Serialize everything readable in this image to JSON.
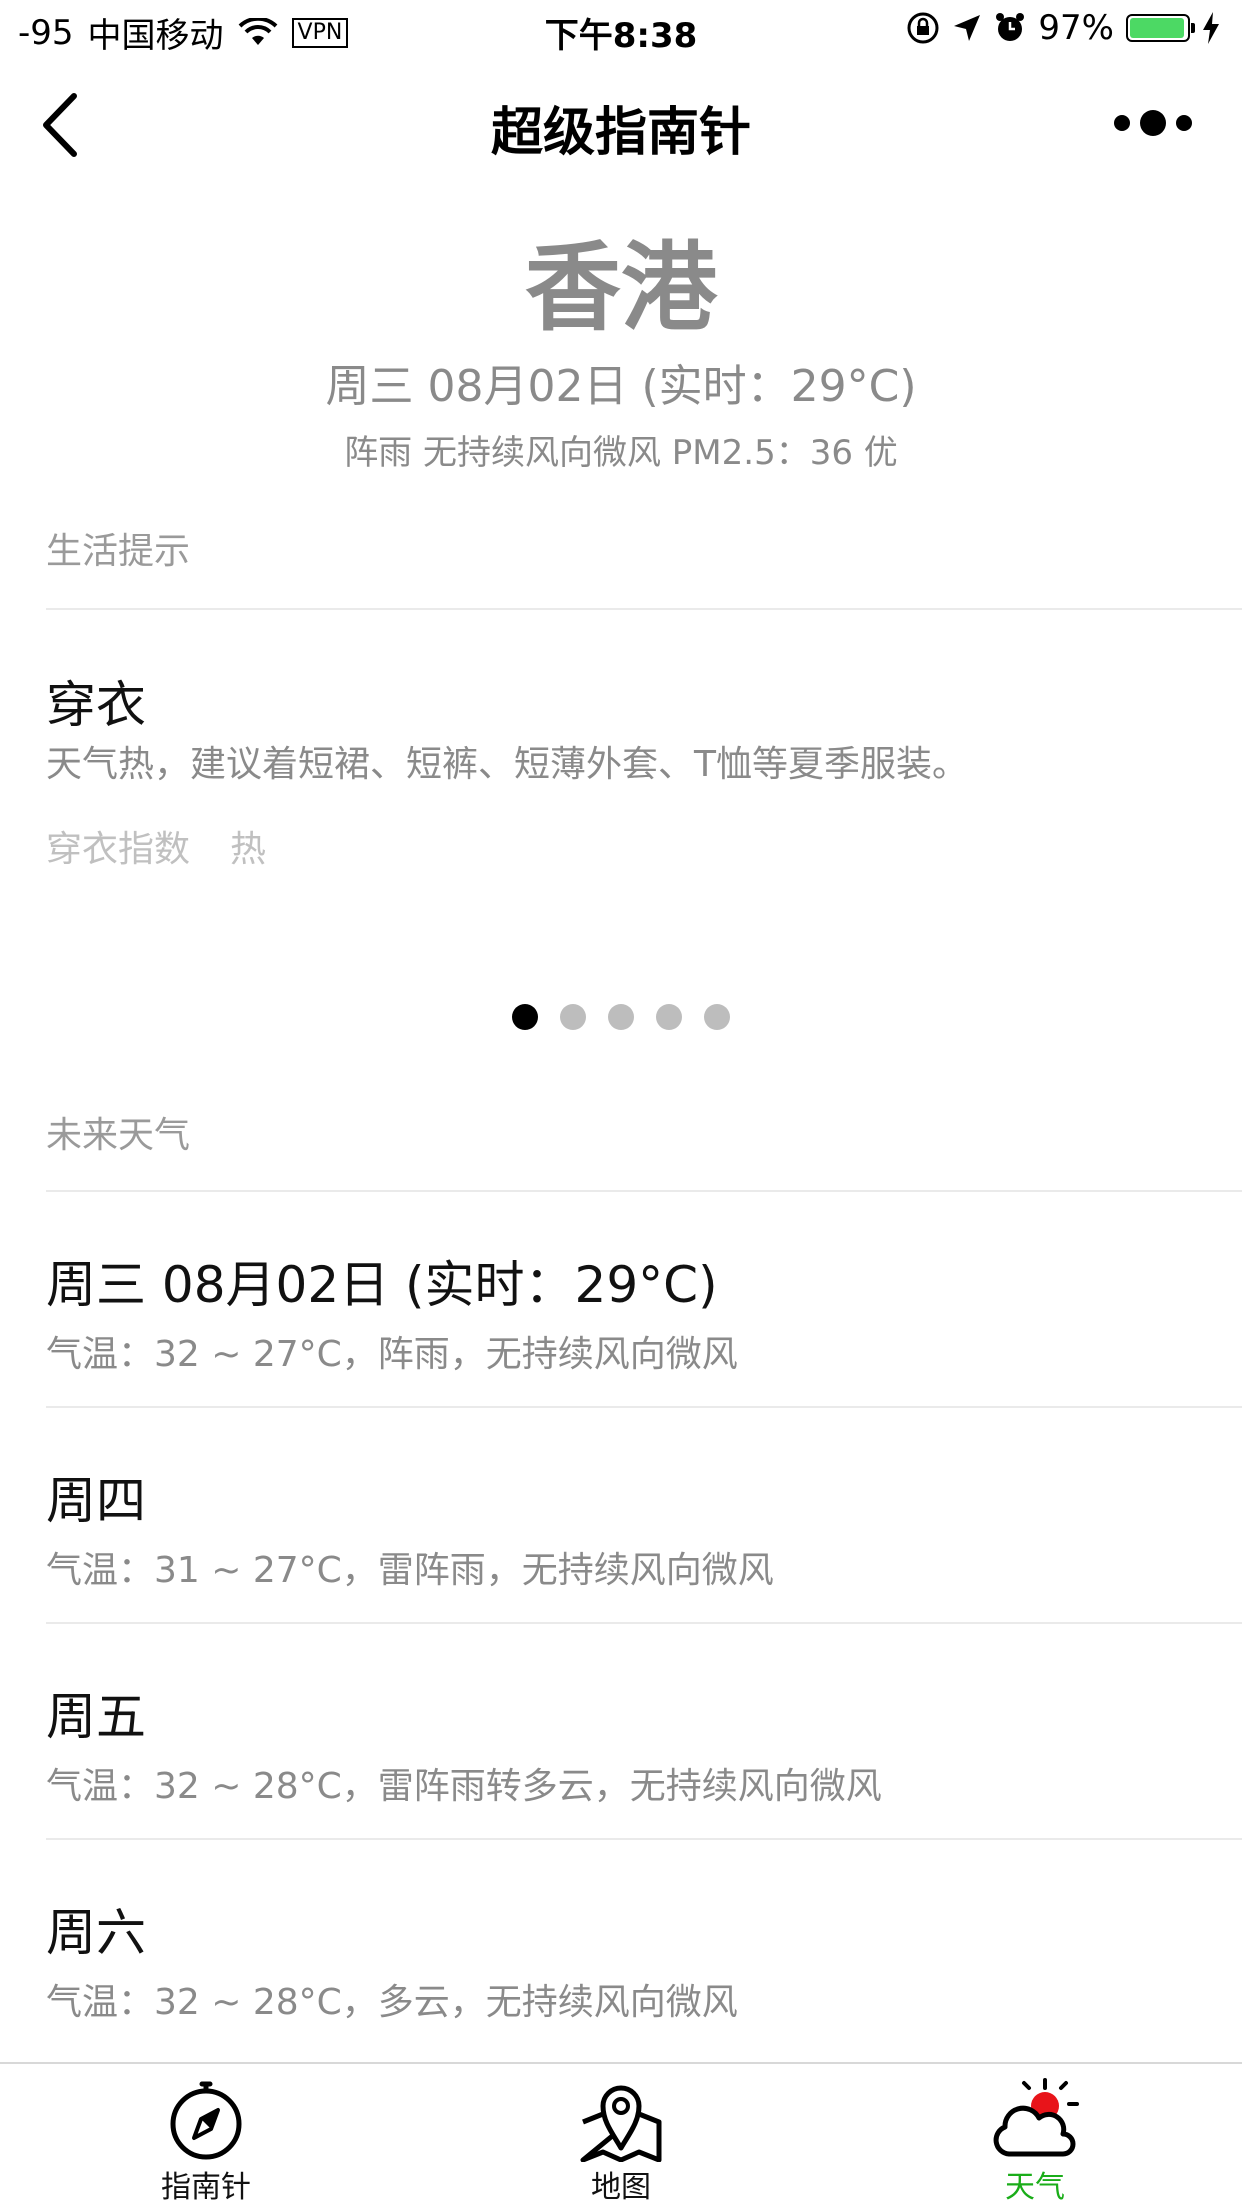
{
  "status_bar": {
    "signal": "-95",
    "carrier": "中国移动",
    "vpn": "VPN",
    "time": "下午8:38",
    "battery_percent": "97%",
    "battery_level": 0.97,
    "battery_color": "#4cd964"
  },
  "navbar": {
    "title": "超级指南针",
    "back_icon": "chevron-left-icon",
    "more_icon": "more-dots-icon"
  },
  "header": {
    "city": "香港",
    "date_line": "周三 08月02日 (实时：29°C)",
    "condition_line": "阵雨 无持续风向微风 PM2.5：36 优"
  },
  "life_tips": {
    "section_label": "生活提示",
    "card": {
      "title": "穿衣",
      "description": "天气热，建议着短裙、短裤、短薄外套、T恤等夏季服装。",
      "index_label": "穿衣指数",
      "index_value": "热"
    },
    "page_count": 5,
    "active_page": 0
  },
  "forecast": {
    "section_label": "未来天气",
    "items": [
      {
        "day": "周三 08月02日 (实时：29°C)",
        "desc": "气温：32 ~ 27°C，阵雨，无持续风向微风"
      },
      {
        "day": "周四",
        "desc": "气温：31 ~ 27°C，雷阵雨，无持续风向微风"
      },
      {
        "day": "周五",
        "desc": "气温：32 ~ 28°C，雷阵雨转多云，无持续风向微风"
      },
      {
        "day": "周六",
        "desc": "气温：32 ~ 28°C，多云，无持续风向微风"
      }
    ]
  },
  "tabbar": {
    "active_color": "#1aad19",
    "tabs": [
      {
        "label": "指南针",
        "icon": "compass-icon"
      },
      {
        "label": "地图",
        "icon": "map-pin-icon"
      },
      {
        "label": "天气",
        "icon": "weather-cloud-sun-icon"
      }
    ]
  }
}
